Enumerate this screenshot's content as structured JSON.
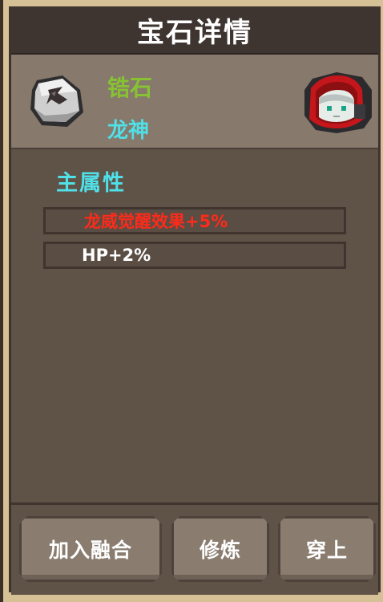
{
  "title": "宝石详情",
  "gem": {
    "name": "锆石",
    "owner": "龙神",
    "icon": "stone-icon",
    "owner_avatar": "hooded-character-avatar"
  },
  "attributes": {
    "heading": "主属性",
    "stats": [
      {
        "text": "龙威觉醒效果+5%",
        "color": "#ff2a1a"
      },
      {
        "text": "HP+2%",
        "color": "#ffffff"
      }
    ]
  },
  "buttons": {
    "fuse": "加入融合",
    "train": "修炼",
    "wear": "穿上"
  },
  "colors": {
    "gem_name": "#86c233",
    "owner_name": "#4fe0e8",
    "heading": "#4fe0e8"
  }
}
